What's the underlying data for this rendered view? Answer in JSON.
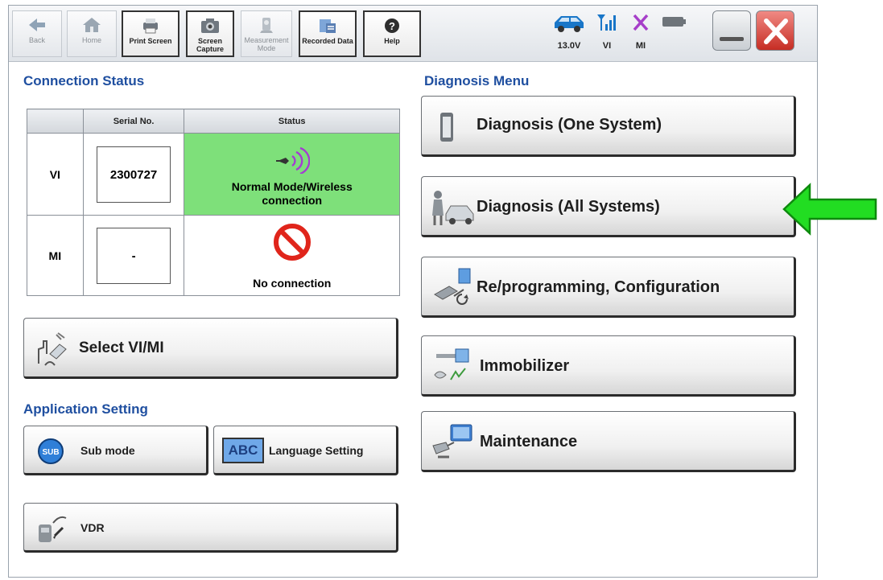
{
  "toolbar": {
    "back": "Back",
    "home": "Home",
    "print_screen": "Print Screen",
    "screen_capture": "Screen Capture",
    "measurement_mode": "Measurement Mode",
    "recorded_data": "Recorded Data",
    "help": "Help"
  },
  "status": {
    "voltage": "13.0V",
    "vi": "VI",
    "mi": "MI"
  },
  "connection_status": {
    "title": "Connection Status",
    "headers": {
      "serial": "Serial No.",
      "status": "Status"
    },
    "rows": [
      {
        "label": "VI",
        "serial": "2300727",
        "status": "Normal Mode/Wireless connection"
      },
      {
        "label": "MI",
        "serial": "-",
        "status": "No connection"
      }
    ]
  },
  "select_vimi": "Select VI/MI",
  "application_setting": {
    "title": "Application Setting",
    "sub_mode": "Sub mode",
    "sub_mode_badge": "SUB",
    "language_setting": "Language Setting",
    "language_badge": "ABC",
    "vdr": "VDR"
  },
  "diagnosis_menu": {
    "title": "Diagnosis Menu",
    "one_system": "Diagnosis (One System)",
    "all_systems": "Diagnosis (All Systems)",
    "reprogramming": "Re/programming, Configuration",
    "immobilizer": "Immobilizer",
    "maintenance": "Maintenance"
  },
  "colors": {
    "title_blue": "#1f4fa0",
    "connected_green": "#7ee07a",
    "arrow_green": "#22dd22",
    "close_red": "#d2362d"
  }
}
